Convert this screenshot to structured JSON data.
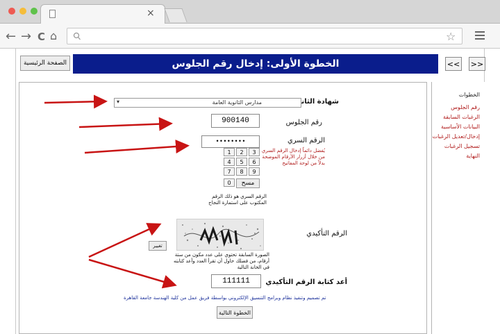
{
  "browser": {
    "window_buttons": {
      "close": "#ee5a52",
      "minimize": "#f5bd3a",
      "maximize": "#5fc24a"
    },
    "tab_close": "×",
    "nav": {
      "back": "←",
      "forward": "→",
      "reload": "C",
      "home": "⌂"
    },
    "search_icon": "search-icon",
    "bookmark_icon": "☆"
  },
  "page": {
    "home_button": "الصفحة الرئيسية",
    "title": "الخطوة الأولى: إدخال رقم الجلوس",
    "nav_prev": "<<",
    "nav_next": ">>",
    "sidebar": {
      "title": "الخطوات",
      "items": [
        "رقم الجلوس",
        "الرغبات السابقة",
        "البيانات الأساسية",
        "إدخال/تعديل الرغبات",
        "تسجيل الرغبات",
        "النهاية"
      ]
    },
    "form": {
      "certificate_label": "شهادة الثانوية",
      "certificate_value": "مدارس الثانوية العامة",
      "seat_label": "رقم الجلوس",
      "seat_value": "900140",
      "password_label": "الرقم السري",
      "password_value": "••••••••",
      "password_hint": "يُفضل دائماً إدخال الرقم السري من خلال أزرار الأرقام الموضحة بدلاً من لوحة المفاتيح",
      "keypad": [
        "1",
        "2",
        "3",
        "4",
        "5",
        "6",
        "7",
        "8",
        "9",
        "0"
      ],
      "clear_button": "مسح",
      "password_note": "الرقم السري هو ذلك الرقم المكتوب على استمارة النجاح",
      "captcha_label": "الرقم التأكيدي",
      "captcha_refresh": "تغيير",
      "captcha_note": "الصورة السابقة تحتوي على عدد مكون من ستة أرقام، من فضلك حاول أن تقرأ العدد وأعد كتابته في الخانة التالية",
      "confirm_label": "أعد كتابة الرقم التأكيدي",
      "confirm_value": "111111",
      "footer_link": "تم تصميم وتنفيذ نظام وبرامج التنسيق الإلكتروني بواسطة فريق عمل من كلية الهندسة جامعة القاهرة",
      "next_button": "الخطوة التالية"
    }
  },
  "colors": {
    "title_bar": "#0a1d8c",
    "annotation_arrow": "#c81414",
    "sidebar_link": "#b01a1a"
  }
}
